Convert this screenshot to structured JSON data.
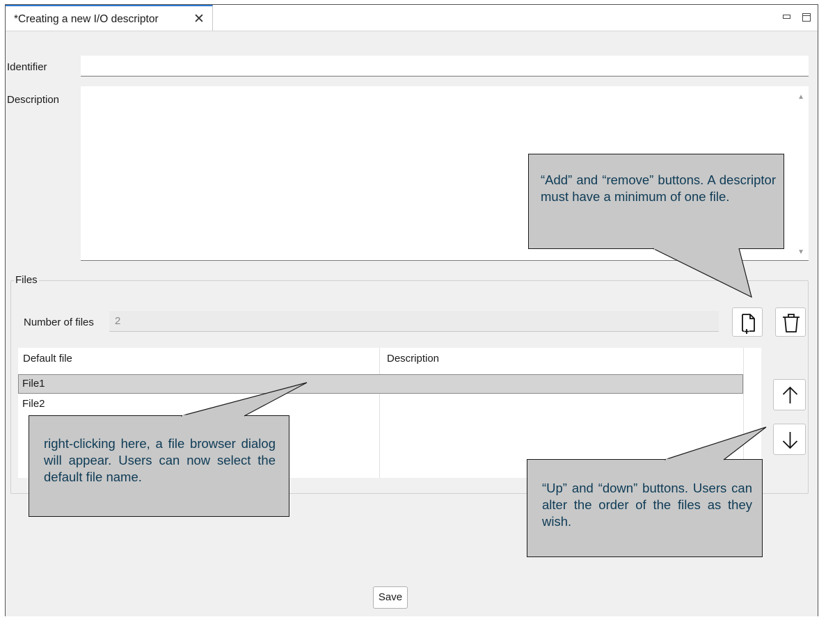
{
  "tab": {
    "title": "*Creating a new I/O descriptor",
    "close_glyph": "✕"
  },
  "form": {
    "identifier_label": "Identifier",
    "identifier_value": "",
    "description_label": "Description",
    "description_value": ""
  },
  "files": {
    "group_label": "Files",
    "number_label": "Number of files",
    "number_value": "2",
    "columns": [
      "Default file",
      "Description"
    ],
    "rows": [
      {
        "file": "File1",
        "description": "",
        "selected": true
      },
      {
        "file": "File2",
        "description": "",
        "selected": false
      }
    ]
  },
  "buttons": {
    "save_label": "Save"
  },
  "icons": {
    "add": "add-file-icon",
    "remove": "trash-icon",
    "up": "arrow-up-icon",
    "down": "arrow-down-icon"
  },
  "callouts": {
    "add_remove": "“Add” and “remove” buttons. A descriptor must have a minimum of one file.",
    "right_click": "right-clicking here, a file browser dialog will appear. Users can now select the default file name.",
    "up_down": "“Up” and “down” buttons. Users can alter the order of the files as they wish."
  },
  "colors": {
    "accent": "#2d7bd4",
    "callout_fill": "#c8c8c8",
    "callout_text": "#0e3b56",
    "panel_bg": "#f0f0f0"
  }
}
